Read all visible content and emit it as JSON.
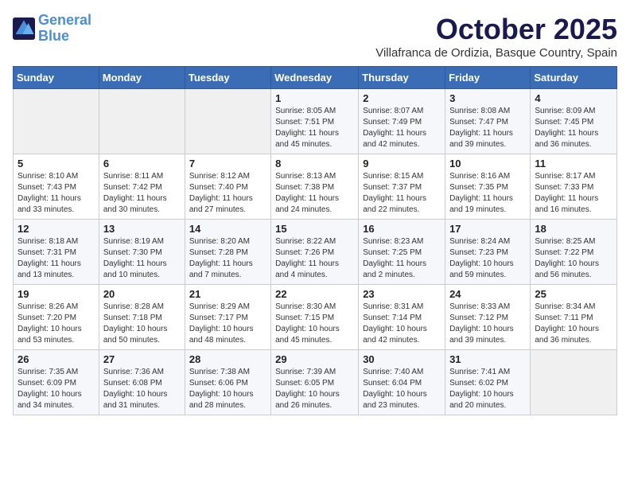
{
  "header": {
    "logo_line1": "General",
    "logo_line2": "Blue",
    "month": "October 2025",
    "location": "Villafranca de Ordizia, Basque Country, Spain"
  },
  "columns": [
    "Sunday",
    "Monday",
    "Tuesday",
    "Wednesday",
    "Thursday",
    "Friday",
    "Saturday"
  ],
  "weeks": [
    [
      {
        "day": "",
        "content": ""
      },
      {
        "day": "",
        "content": ""
      },
      {
        "day": "",
        "content": ""
      },
      {
        "day": "1",
        "content": "Sunrise: 8:05 AM\nSunset: 7:51 PM\nDaylight: 11 hours and 45 minutes."
      },
      {
        "day": "2",
        "content": "Sunrise: 8:07 AM\nSunset: 7:49 PM\nDaylight: 11 hours and 42 minutes."
      },
      {
        "day": "3",
        "content": "Sunrise: 8:08 AM\nSunset: 7:47 PM\nDaylight: 11 hours and 39 minutes."
      },
      {
        "day": "4",
        "content": "Sunrise: 8:09 AM\nSunset: 7:45 PM\nDaylight: 11 hours and 36 minutes."
      }
    ],
    [
      {
        "day": "5",
        "content": "Sunrise: 8:10 AM\nSunset: 7:43 PM\nDaylight: 11 hours and 33 minutes."
      },
      {
        "day": "6",
        "content": "Sunrise: 8:11 AM\nSunset: 7:42 PM\nDaylight: 11 hours and 30 minutes."
      },
      {
        "day": "7",
        "content": "Sunrise: 8:12 AM\nSunset: 7:40 PM\nDaylight: 11 hours and 27 minutes."
      },
      {
        "day": "8",
        "content": "Sunrise: 8:13 AM\nSunset: 7:38 PM\nDaylight: 11 hours and 24 minutes."
      },
      {
        "day": "9",
        "content": "Sunrise: 8:15 AM\nSunset: 7:37 PM\nDaylight: 11 hours and 22 minutes."
      },
      {
        "day": "10",
        "content": "Sunrise: 8:16 AM\nSunset: 7:35 PM\nDaylight: 11 hours and 19 minutes."
      },
      {
        "day": "11",
        "content": "Sunrise: 8:17 AM\nSunset: 7:33 PM\nDaylight: 11 hours and 16 minutes."
      }
    ],
    [
      {
        "day": "12",
        "content": "Sunrise: 8:18 AM\nSunset: 7:31 PM\nDaylight: 11 hours and 13 minutes."
      },
      {
        "day": "13",
        "content": "Sunrise: 8:19 AM\nSunset: 7:30 PM\nDaylight: 11 hours and 10 minutes."
      },
      {
        "day": "14",
        "content": "Sunrise: 8:20 AM\nSunset: 7:28 PM\nDaylight: 11 hours and 7 minutes."
      },
      {
        "day": "15",
        "content": "Sunrise: 8:22 AM\nSunset: 7:26 PM\nDaylight: 11 hours and 4 minutes."
      },
      {
        "day": "16",
        "content": "Sunrise: 8:23 AM\nSunset: 7:25 PM\nDaylight: 11 hours and 2 minutes."
      },
      {
        "day": "17",
        "content": "Sunrise: 8:24 AM\nSunset: 7:23 PM\nDaylight: 10 hours and 59 minutes."
      },
      {
        "day": "18",
        "content": "Sunrise: 8:25 AM\nSunset: 7:22 PM\nDaylight: 10 hours and 56 minutes."
      }
    ],
    [
      {
        "day": "19",
        "content": "Sunrise: 8:26 AM\nSunset: 7:20 PM\nDaylight: 10 hours and 53 minutes."
      },
      {
        "day": "20",
        "content": "Sunrise: 8:28 AM\nSunset: 7:18 PM\nDaylight: 10 hours and 50 minutes."
      },
      {
        "day": "21",
        "content": "Sunrise: 8:29 AM\nSunset: 7:17 PM\nDaylight: 10 hours and 48 minutes."
      },
      {
        "day": "22",
        "content": "Sunrise: 8:30 AM\nSunset: 7:15 PM\nDaylight: 10 hours and 45 minutes."
      },
      {
        "day": "23",
        "content": "Sunrise: 8:31 AM\nSunset: 7:14 PM\nDaylight: 10 hours and 42 minutes."
      },
      {
        "day": "24",
        "content": "Sunrise: 8:33 AM\nSunset: 7:12 PM\nDaylight: 10 hours and 39 minutes."
      },
      {
        "day": "25",
        "content": "Sunrise: 8:34 AM\nSunset: 7:11 PM\nDaylight: 10 hours and 36 minutes."
      }
    ],
    [
      {
        "day": "26",
        "content": "Sunrise: 7:35 AM\nSunset: 6:09 PM\nDaylight: 10 hours and 34 minutes."
      },
      {
        "day": "27",
        "content": "Sunrise: 7:36 AM\nSunset: 6:08 PM\nDaylight: 10 hours and 31 minutes."
      },
      {
        "day": "28",
        "content": "Sunrise: 7:38 AM\nSunset: 6:06 PM\nDaylight: 10 hours and 28 minutes."
      },
      {
        "day": "29",
        "content": "Sunrise: 7:39 AM\nSunset: 6:05 PM\nDaylight: 10 hours and 26 minutes."
      },
      {
        "day": "30",
        "content": "Sunrise: 7:40 AM\nSunset: 6:04 PM\nDaylight: 10 hours and 23 minutes."
      },
      {
        "day": "31",
        "content": "Sunrise: 7:41 AM\nSunset: 6:02 PM\nDaylight: 10 hours and 20 minutes."
      },
      {
        "day": "",
        "content": ""
      }
    ]
  ]
}
